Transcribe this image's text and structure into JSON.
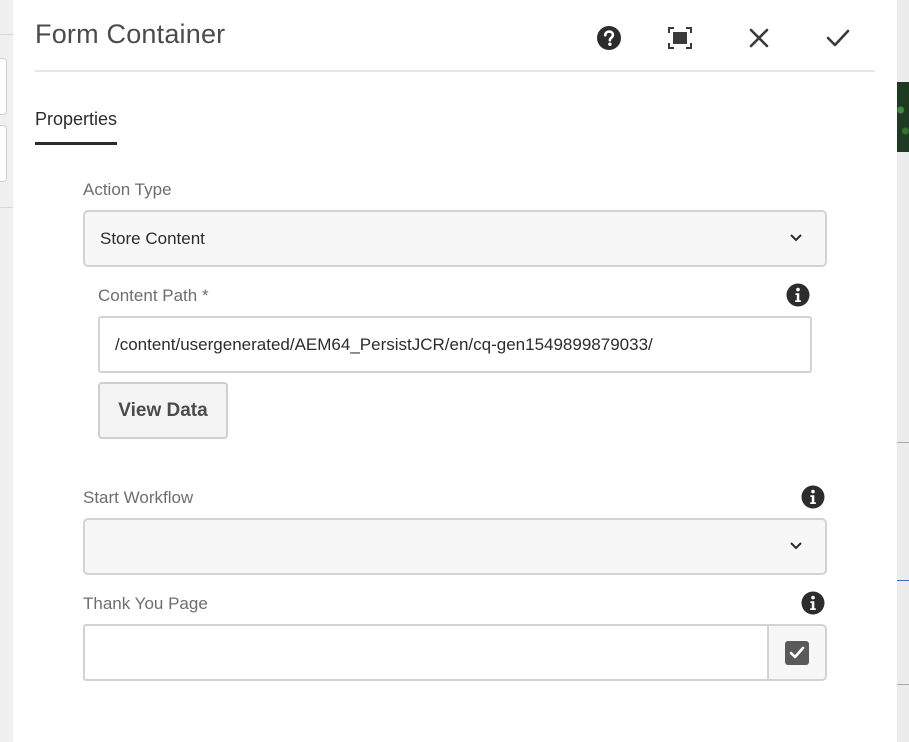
{
  "dialog": {
    "title": "Form Container",
    "header_icons": [
      "help-icon",
      "fullscreen-icon",
      "close-icon",
      "check-icon"
    ]
  },
  "tabs": [
    {
      "label": "Properties",
      "active": true
    }
  ],
  "form": {
    "action_type": {
      "label": "Action Type",
      "value": "Store Content"
    },
    "content_path": {
      "label": "Content Path *",
      "value": "/content/usergenerated/AEM64_PersistJCR/en/cq-gen1549899879033/"
    },
    "view_data_button": "View Data",
    "start_workflow": {
      "label": "Start Workflow",
      "value": ""
    },
    "thank_you_page": {
      "label": "Thank You Page",
      "value": ""
    }
  },
  "colors": {
    "text": "#4b4b4b",
    "border": "#d3d3d3",
    "active_tab": "#2c2c2c",
    "icon": "#2c2c2c"
  }
}
